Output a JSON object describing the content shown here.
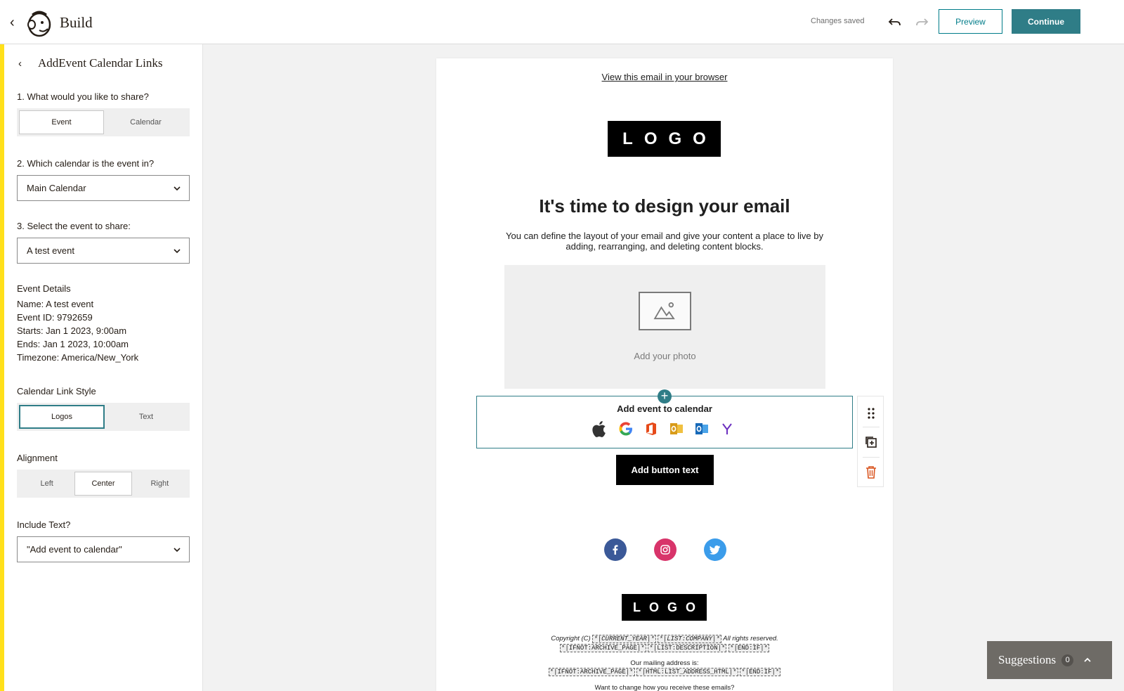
{
  "topbar": {
    "title": "Build",
    "status": "Changes saved",
    "preview_label": "Preview",
    "continue_label": "Continue"
  },
  "panel": {
    "title": "AddEvent Calendar Links",
    "q1": {
      "label": "1. What would you like to share?",
      "options": [
        "Event",
        "Calendar"
      ],
      "selected": "Event"
    },
    "q2": {
      "label": "2. Which calendar is the event in?",
      "value": "Main Calendar"
    },
    "q3": {
      "label": "3. Select the event to share:",
      "value": "A test event"
    },
    "details": {
      "heading": "Event Details",
      "lines": [
        "Name: A test event",
        "Event ID: 9792659",
        "Starts: Jan 1 2023, 9:00am",
        "Ends: Jan 1 2023, 10:00am",
        "Timezone: America/New_York"
      ]
    },
    "link_style": {
      "label": "Calendar Link Style",
      "options": [
        "Logos",
        "Text"
      ],
      "selected": "Logos"
    },
    "alignment": {
      "label": "Alignment",
      "options": [
        "Left",
        "Center",
        "Right"
      ],
      "selected": "Center"
    },
    "include_text": {
      "label": "Include Text?",
      "value": "\"Add event to calendar\""
    }
  },
  "email": {
    "view_browser": "View this email in your browser",
    "logo_text": "LOGO",
    "heading": "It's time to design your email",
    "body": "You can define the layout of your email and give your content a place to live by adding, rearranging, and deleting content blocks.",
    "photo_label": "Add your photo",
    "calendar_title": "Add event to calendar",
    "calendar_icons": [
      "apple-icon",
      "google-icon",
      "office365-icon",
      "outlook-icon",
      "outlook-com-icon",
      "yahoo-icon"
    ],
    "button_text": "Add button text",
    "social": [
      "facebook-icon",
      "instagram-icon",
      "twitter-icon"
    ],
    "footer": {
      "copyright_prefix": "Copyright (C)",
      "merge_year": "*|CURRENT_YEAR|*",
      "merge_company": "*|LIST:COMPANY|*",
      "rights": "All rights reserved.",
      "merge_line2a": "*|IFNOT:ARCHIVE_PAGE|*",
      "merge_line2b": "*|LIST:DESCRIPTION|*",
      "merge_line2c": "*|END:IF|*",
      "mailing_label": "Our mailing address is:",
      "merge_line4a": "*|IFNOT:ARCHIVE_PAGE|*",
      "merge_line4b": "*|HTML:LIST_ADDRESS_HTML|*",
      "merge_line4c": "*|END:IF|*",
      "change_text": "Want to change how you receive these emails?"
    }
  },
  "suggestions": {
    "label": "Suggestions",
    "count": "0"
  },
  "colors": {
    "accent": "#2f7d87",
    "yellow": "#ffe01b",
    "danger": "#d9541e"
  }
}
